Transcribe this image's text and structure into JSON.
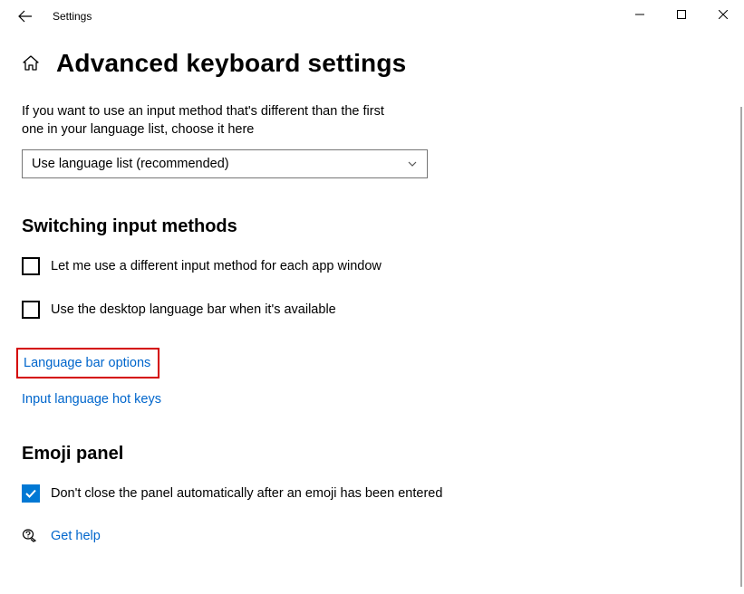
{
  "titlebar": {
    "title": "Settings"
  },
  "page": {
    "title": "Advanced keyboard settings",
    "description": "If you want to use an input method that's different than the first one in your language list, choose it here"
  },
  "dropdown": {
    "selected": "Use language list (recommended)"
  },
  "sections": {
    "switching": {
      "heading": "Switching input methods",
      "cb1": "Let me use a different input method for each app window",
      "cb2": "Use the desktop language bar when it's available",
      "link1": "Language bar options",
      "link2": "Input language hot keys"
    },
    "emoji": {
      "heading": "Emoji panel",
      "cb1": "Don't close the panel automatically after an emoji has been entered"
    }
  },
  "footer": {
    "help": "Get help"
  }
}
